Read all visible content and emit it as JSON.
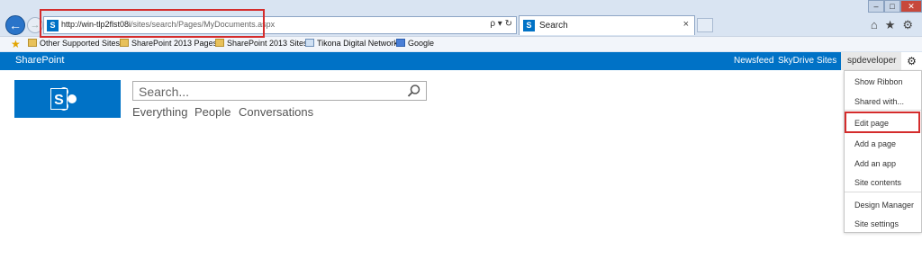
{
  "browser": {
    "address": {
      "url_prefix": "http://win-tlp2flst08i",
      "url_suffix": "/sites/search/Pages/MyDocuments.aspx",
      "controls": "ρ ▾ ↻"
    },
    "tab": {
      "title": "Search",
      "close": "×"
    },
    "window_buttons": {
      "minimize": "–",
      "maximize": "□",
      "close": "✕"
    },
    "right_icons": {
      "home": "⌂",
      "favorites": "★",
      "tools": "⚙"
    },
    "favorites": [
      {
        "label": "Other Supported Sites ▾"
      },
      {
        "label": "SharePoint 2013 Pages ▾"
      },
      {
        "label": "SharePoint 2013 Sites ▾"
      },
      {
        "label": "Tikona Digital Networks"
      },
      {
        "label": "Google"
      }
    ]
  },
  "suite_bar": {
    "brand": "SharePoint",
    "links": [
      "Newsfeed",
      "SkyDrive",
      "Sites"
    ],
    "user": "spdeveloper ▾",
    "gear": "⚙"
  },
  "search": {
    "placeholder": "Search...",
    "scopes": [
      "Everything",
      "People",
      "Conversations"
    ]
  },
  "settings_menu": {
    "items": [
      "Show Ribbon",
      "Shared with...",
      "Edit page",
      "Add a page",
      "Add an app",
      "Site contents",
      "Design Manager",
      "Site settings"
    ],
    "highlighted": "Edit page"
  },
  "colors": {
    "suite_bar": "#0072c6",
    "highlight_box": "#d42c2c",
    "chrome": "#d9e4f2"
  }
}
